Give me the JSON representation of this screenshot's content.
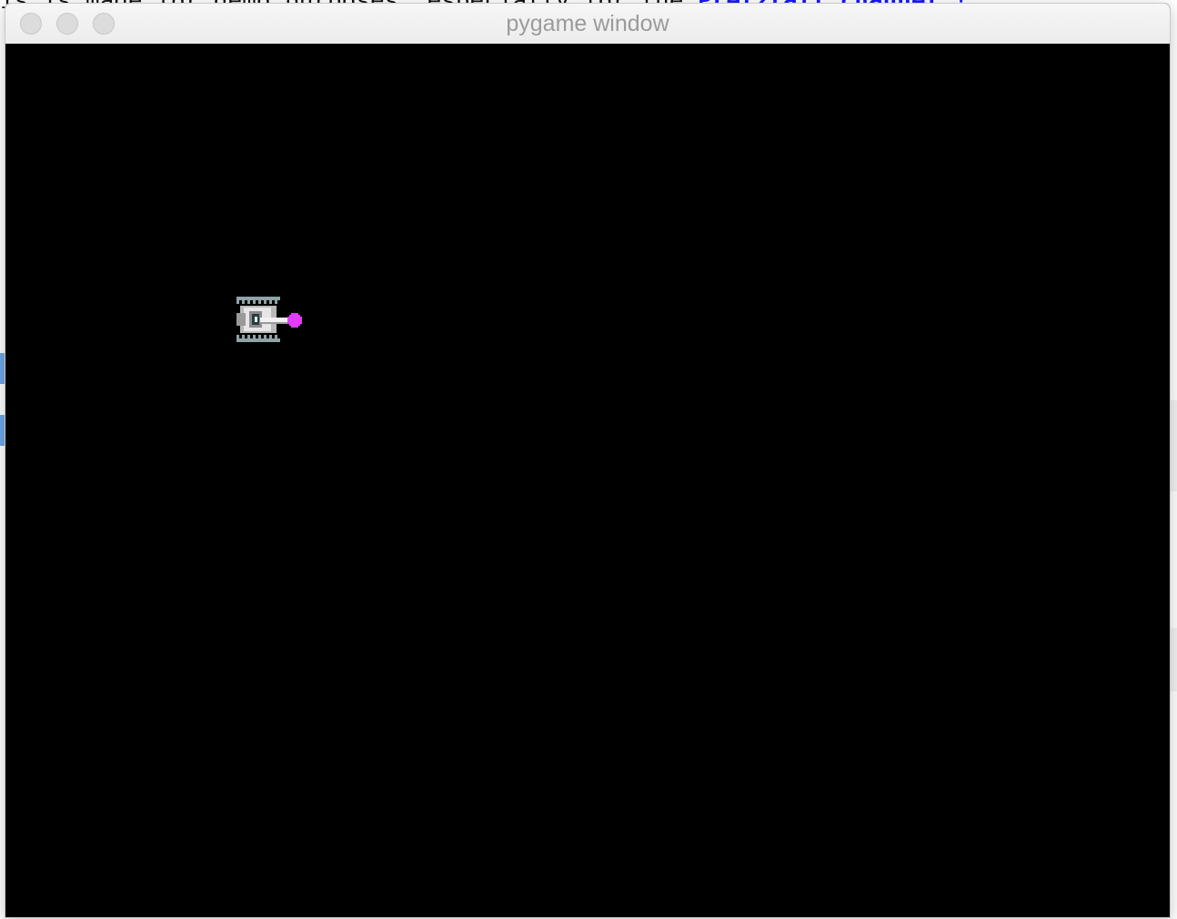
{
  "background": {
    "text_line": "is is made for demo purposes: especially for the",
    "link_text": "Pretzlaff channel !"
  },
  "window": {
    "title": "pygame window"
  },
  "game": {
    "sprites": [
      {
        "name": "tank",
        "icon": "tank-sprite",
        "facing": "right"
      },
      {
        "name": "projectile",
        "icon": "magenta-shot",
        "color": "#e23cff"
      }
    ],
    "colors": {
      "background": "#000000",
      "tank_body": "#c8c8c8",
      "tank_treads": "#8fa3a6",
      "projectile": "#e23cff"
    }
  }
}
